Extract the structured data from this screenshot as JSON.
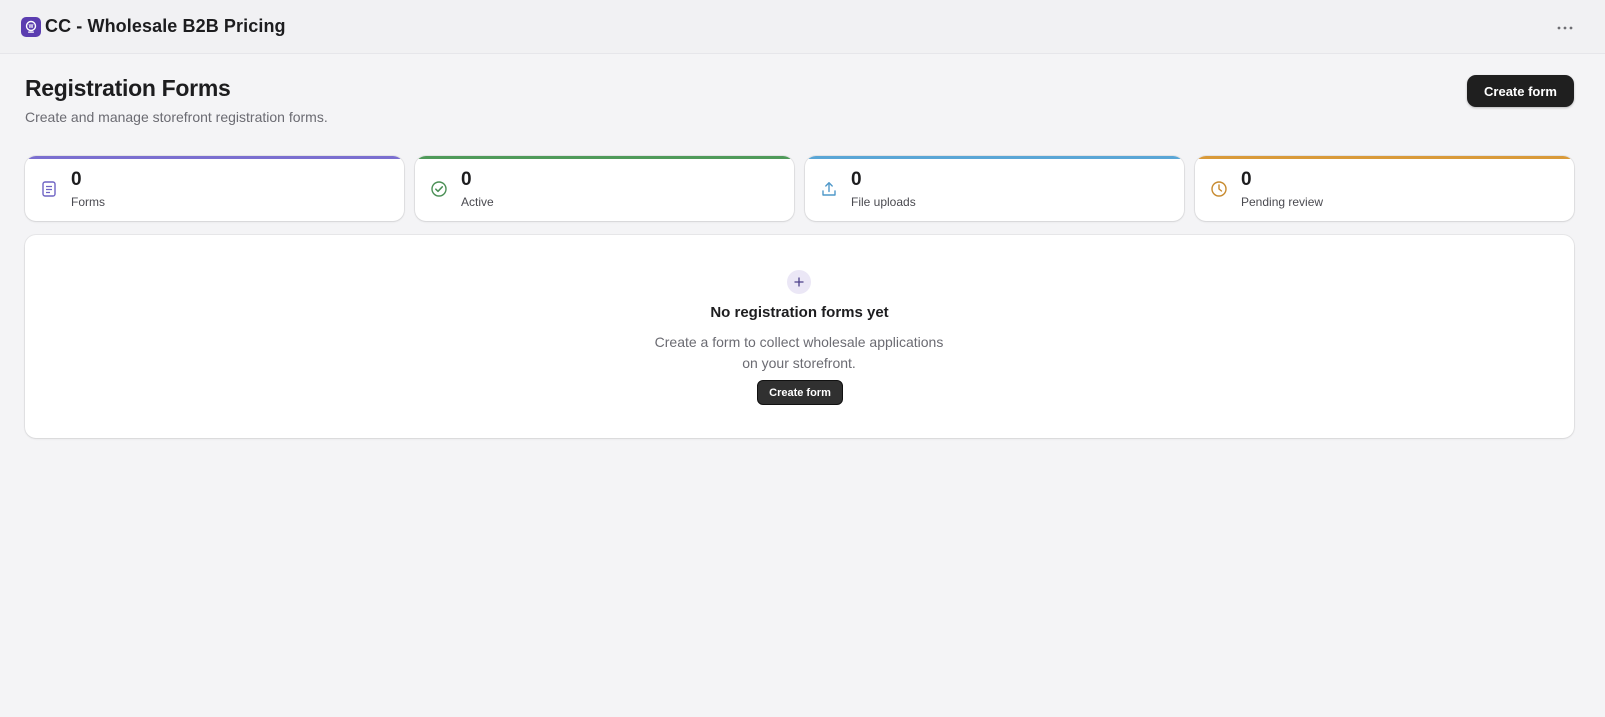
{
  "app": {
    "title": "CC - Wholesale B2B Pricing",
    "logo_icon": "app-logo-icon",
    "logo_color": "#5b3db0",
    "more_icon": "more-horizontal-icon"
  },
  "header": {
    "title": "Registration Forms",
    "subtitle": "Create and manage storefront registration forms.",
    "create_button_label": "Create form"
  },
  "stats": [
    {
      "value": "0",
      "label": "Forms",
      "icon": "document-icon",
      "accent": "#7b6fd0"
    },
    {
      "value": "0",
      "label": "Active",
      "icon": "check-circle-icon",
      "accent": "#4f9a5a"
    },
    {
      "value": "0",
      "label": "File uploads",
      "icon": "upload-icon",
      "accent": "#5aa6d6"
    },
    {
      "value": "0",
      "label": "Pending review",
      "icon": "clock-icon",
      "accent": "#d99a3a"
    }
  ],
  "empty_state": {
    "icon": "plus-icon",
    "title": "No registration forms yet",
    "description": "Create a form to collect wholesale applications on your storefront.",
    "button_label": "Create form"
  }
}
